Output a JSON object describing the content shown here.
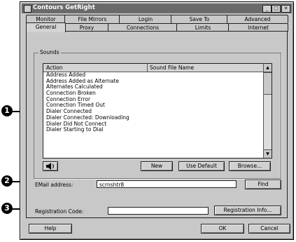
{
  "window": {
    "title": "Contours GetRight",
    "minimize_label": "_",
    "maximize_label": "□",
    "close_label": "✕"
  },
  "tabs_row1": [
    {
      "label": "Monitor"
    },
    {
      "label": "File Mirrors"
    },
    {
      "label": "Login"
    },
    {
      "label": "Save To"
    },
    {
      "label": "Advanced"
    }
  ],
  "tabs_row2": [
    {
      "label": "General",
      "active": true
    },
    {
      "label": "Proxy"
    },
    {
      "label": "Connections"
    },
    {
      "label": "Limits"
    },
    {
      "label": "Internet"
    }
  ],
  "sounds": {
    "group_label": "Sounds",
    "columns": {
      "action": "Action",
      "file": "Sound File Name"
    },
    "rows": [
      "Address Added",
      "Address Added as Alternate",
      "Alternates Calculated",
      "Connection Broken",
      "Connection Error",
      "Connection Timed Out",
      "Dialer Connected",
      "Dialer Connected: Downloading",
      "Dialer Did Not Connect",
      "Dialer Starting to Dial"
    ],
    "scroll_up": "▲",
    "scroll_down": "▼",
    "speaker_icon": "speaker-icon",
    "buttons": {
      "new": "New",
      "use_default": "Use Default",
      "browse": "Browse..."
    }
  },
  "email": {
    "label": "EMail address:",
    "value": "scrnshtr8",
    "find_button": "Find"
  },
  "registration": {
    "label": "Registration Code:",
    "value": "",
    "info_button": "Registration Info..."
  },
  "footer": {
    "help": "Help",
    "ok": "OK",
    "cancel": "Cancel"
  },
  "callouts": [
    "1",
    "2",
    "3"
  ]
}
